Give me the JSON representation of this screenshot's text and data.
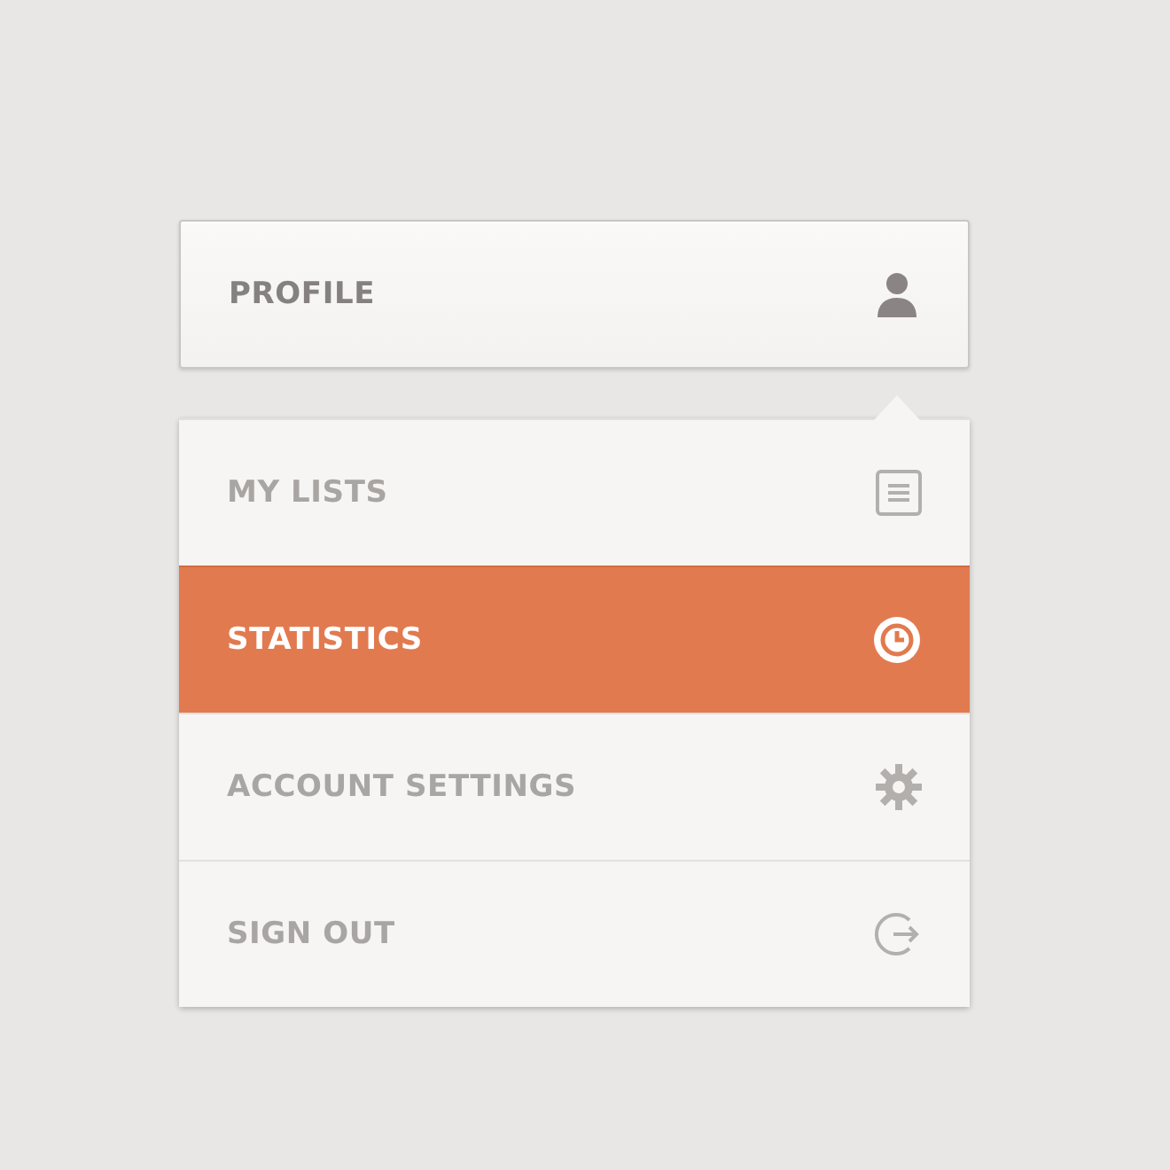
{
  "profile_button": {
    "label": "PROFILE"
  },
  "menu": {
    "items": [
      {
        "label": "MY LISTS",
        "selected": false
      },
      {
        "label": "STATISTICS",
        "selected": true
      },
      {
        "label": "ACCOUNT SETTINGS",
        "selected": false
      },
      {
        "label": "SIGN OUT",
        "selected": false
      }
    ]
  }
}
